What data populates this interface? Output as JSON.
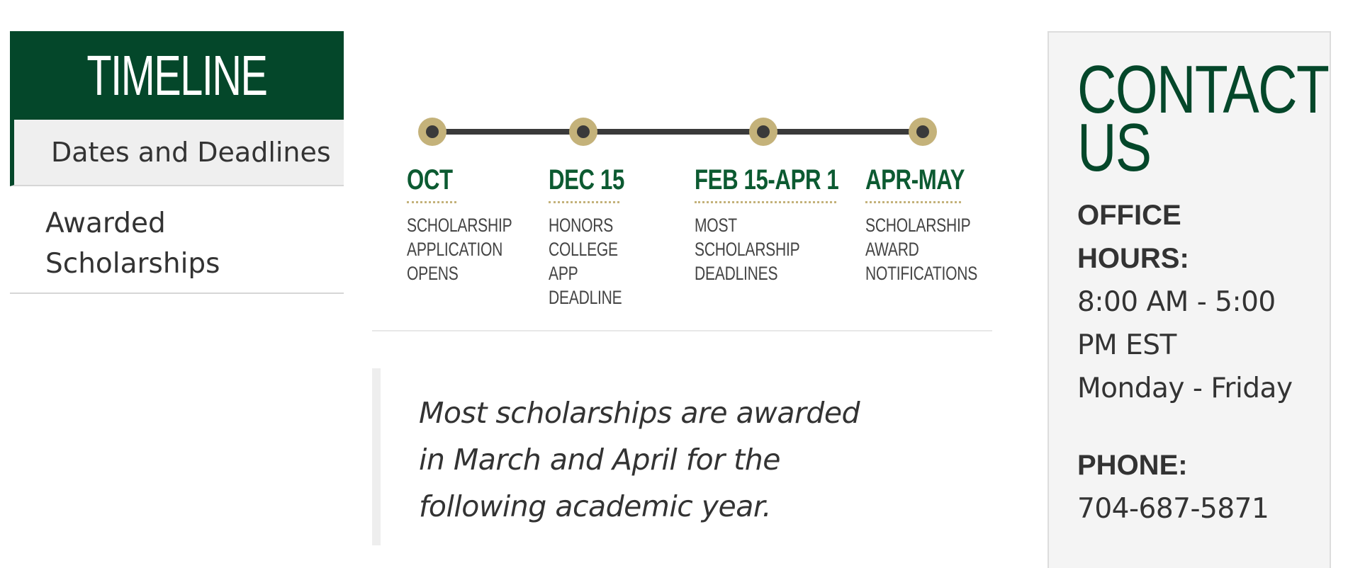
{
  "sidenav": {
    "title": "TIMELINE",
    "items": [
      {
        "label": "Dates and Deadlines",
        "active": true
      },
      {
        "label": "Awarded Scholarships",
        "active": false
      }
    ]
  },
  "timeline": {
    "line_color": "#3a3a3a",
    "node_color": "#c4b27a",
    "milestones": [
      {
        "date": "OCT",
        "description": "SCHOLARSHIP\nAPPLICATION\nOPENS"
      },
      {
        "date": "DEC 15",
        "description": "HONORS\nCOLLEGE\nAPP DEADLINE"
      },
      {
        "date": "FEB 15-APR 1",
        "description": "MOST\nSCHOLARSHIP\nDEADLINES"
      },
      {
        "date": "APR-MAY",
        "description": "SCHOLARSHIP\nAWARD\nNOTIFICATIONS"
      }
    ]
  },
  "quote": {
    "text": "Most scholarships are awarded in March and April for the following academic year."
  },
  "contact": {
    "title": "CONTACT US",
    "hours_label": "OFFICE HOURS:",
    "hours_time": "8:00 AM - 5:00 PM EST",
    "hours_days": "Monday - Friday",
    "phone_label": "PHONE:",
    "phone": "704-687-5871"
  },
  "colors": {
    "brand_green": "#04472a",
    "date_green": "#0c5a31",
    "gold": "#c4b27a"
  }
}
